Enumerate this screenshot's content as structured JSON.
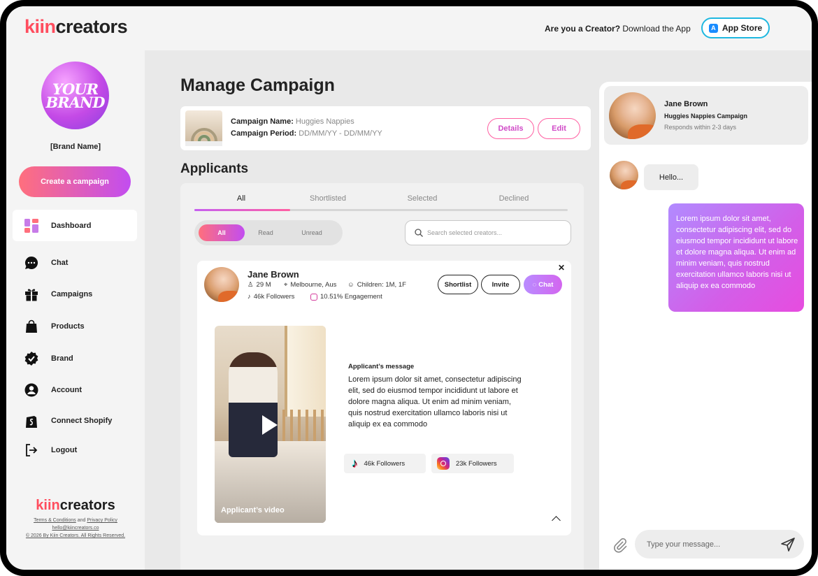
{
  "header": {
    "logo_a": "kiin",
    "logo_b": "creators",
    "creator_question": "Are you a Creator?",
    "download_text": "Download the App",
    "appstore_label": "App Store"
  },
  "sidebar": {
    "brand_logo_line1": "YOUR",
    "brand_logo_line2": "BRAND",
    "brand_name": "[Brand Name]",
    "create_campaign": "Create a campaign",
    "items": [
      {
        "label": "Dashboard",
        "icon": "dashboard-icon"
      },
      {
        "label": "Chat",
        "icon": "chat-icon"
      },
      {
        "label": "Campaigns",
        "icon": "gift-icon"
      },
      {
        "label": "Products",
        "icon": "shopping-bag-icon"
      },
      {
        "label": "Brand",
        "icon": "verified-badge-icon"
      },
      {
        "label": "Account",
        "icon": "account-icon"
      },
      {
        "label": "Connect Shopify",
        "icon": "shopify-icon"
      },
      {
        "label": "Logout",
        "icon": "logout-icon"
      }
    ],
    "footer": {
      "logo_a": "kiin",
      "logo_b": "creators",
      "terms": "Terms & Conditions",
      "and": "and",
      "privacy": "Privacy Policy",
      "email": "hello@kiincreators.co",
      "copyright": "© 2026 By Kiin Creators. All Rights Reserved."
    }
  },
  "main": {
    "title": "Manage Campaign",
    "campaign": {
      "name_label": "Campaign Name:",
      "name_value": "Huggies Nappies",
      "period_label": "Campaign Period:",
      "period_value": "DD/MM/YY - DD/MM/YY",
      "details_btn": "Details",
      "edit_btn": "Edit"
    },
    "applicants_title": "Applicants",
    "tabs": [
      "All",
      "Shortlisted",
      "Selected",
      "Declined"
    ],
    "filters": [
      "All",
      "Read",
      "Unread"
    ],
    "search_placeholder": "Search selected creators...",
    "applicant": {
      "name": "Jane Brown",
      "age": "29 M",
      "location": "Melbourne, Aus",
      "children": "Children: 1M, 1F",
      "tiktok_followers": "46k Followers",
      "engagement": "10.51% Engagement",
      "shortlist_btn": "Shortlist",
      "invite_btn": "Invite",
      "chat_btn": "Chat",
      "video_label": "Applicant’s video",
      "message_heading": "Applicant’s message",
      "message": "Lorem ipsum dolor sit amet, consectetur adipiscing elit, sed do eiusmod tempor incididunt ut labore et dolore magna aliqua. Ut enim ad minim veniam, quis nostrud exercitation ullamco laboris nisi ut aliquip ex ea commodo",
      "tiktok_box": "46k Followers",
      "instagram_box": "23k Followers"
    }
  },
  "chat": {
    "name": "Jane Brown",
    "campaign": "Huggies Nappies Campaign",
    "responds": "Responds within 2-3 days",
    "incoming": "Hello...",
    "outgoing": "Lorem ipsum dolor sit amet, consectetur adipiscing elit, sed do eiusmod tempor incididunt ut labore et dolore magna aliqua. Ut enim ad minim veniam, quis nostrud exercitation ullamco laboris nisi ut aliquip ex ea commodo",
    "input_placeholder": "Type your message..."
  },
  "colors": {
    "brand_red": "#ff4d5e",
    "accent_purple": "#c24df0",
    "appstore_border": "#1fb8e0"
  }
}
